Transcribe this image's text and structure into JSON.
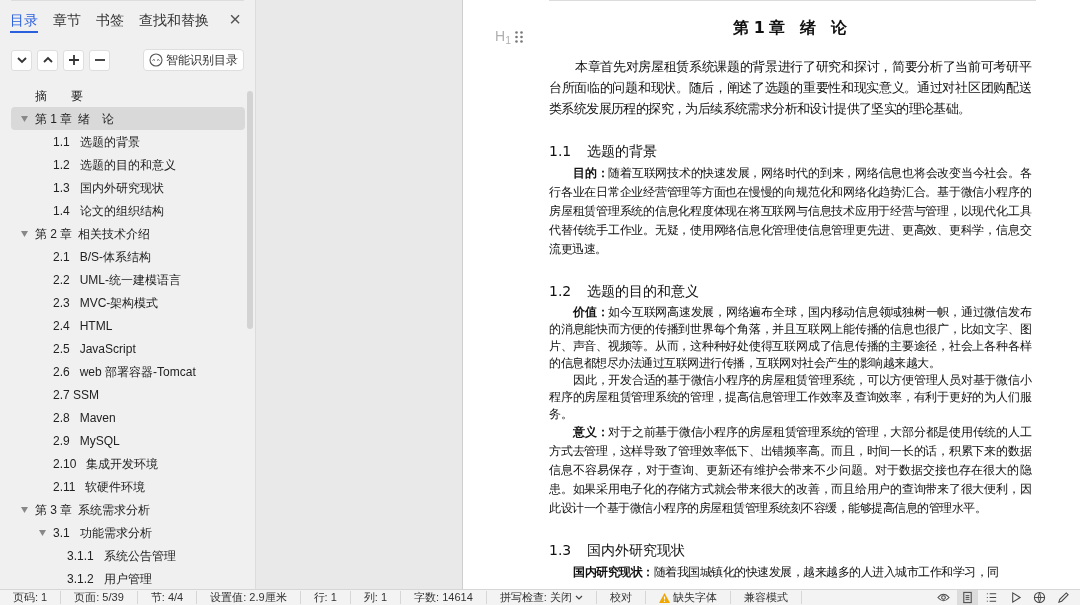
{
  "sidebar": {
    "tabs": [
      {
        "label": "目录",
        "selected": true
      },
      {
        "label": "章节",
        "selected": false
      },
      {
        "label": "书签",
        "selected": false
      },
      {
        "label": "查找和替换",
        "selected": false
      }
    ],
    "close": "×",
    "smart_button": "智能识别目录",
    "toc": [
      {
        "title": "摘　　要",
        "selected": false
      },
      {
        "num": "第 1 章",
        "title": "绪　论",
        "selected": true,
        "expanded": true,
        "children": [
          {
            "num": "1.1",
            "title": "选题的背景",
            "selected": false
          },
          {
            "num": "1.2",
            "title": "选题的目的和意义",
            "selected": false
          },
          {
            "num": "1.3",
            "title": "国内外研究现状",
            "selected": false
          },
          {
            "num": "1.4",
            "title": "论文的组织结构",
            "selected": false
          }
        ]
      },
      {
        "num": "第 2 章",
        "title": "相关技术介绍",
        "selected": false,
        "expanded": true,
        "children": [
          {
            "num": "2.1",
            "title": "B/S-体系结构",
            "selected": false
          },
          {
            "num": "2.2",
            "title": "UML-统一建模语言",
            "selected": false
          },
          {
            "num": "2.3",
            "title": "MVC-架构模式",
            "selected": false
          },
          {
            "num": "2.4",
            "title": "HTML",
            "selected": false
          },
          {
            "num": "2.5",
            "title": "JavaScript",
            "selected": false
          },
          {
            "num": "2.6",
            "title": "web 部署容器-Tomcat",
            "selected": false
          },
          {
            "num": "2.7 SSM",
            "selected": false
          },
          {
            "num": "2.8",
            "title": "Maven",
            "selected": false
          },
          {
            "num": "2.9",
            "title": "MySQL",
            "selected": false
          },
          {
            "num": "2.10",
            "title": "集成开发环境",
            "selected": false
          },
          {
            "num": "2.11",
            "title": "软硬件环境",
            "selected": false
          }
        ]
      },
      {
        "num": "第 3 章",
        "title": "系统需求分析",
        "selected": false,
        "expanded": true,
        "children": [
          {
            "num": "3.1",
            "title": "功能需求分析",
            "selected": false,
            "expanded": true,
            "children": [
              {
                "num": "3.1.1",
                "title": "系统公告管理",
                "selected": false
              },
              {
                "num": "3.1.2",
                "title": "用户管理",
                "selected": false
              }
            ]
          }
        ]
      }
    ]
  },
  "document": {
    "heading_marker": "H$_{1}$",
    "blocks": [
      {
        "kind": "title",
        "text": "第 1 章　绪　论"
      },
      {
        "kind": "intro",
        "text": "本章首先对房屋租赁系统课题的背景进行了研究和探讨，简要分析了当前可考研平台所面临的问题和现状。随后，阐述了选题的重要性和现实意义。通过对社区团购配送类系统发展历程的探究，为后续系统需求分析和设计提供了坚实的理论基础。"
      },
      {
        "kind": "heading",
        "num": "1.1",
        "text": "选题的背景"
      },
      {
        "kind": "para",
        "text": "**目的：**随着互联网技术的快速发展，网络时代的到来，网络信息也将会改变当今社会。各行各业在日常企业经营管理等方面也在慢慢的向规范化和网络化趋势汇合。基于微信小程序的房屋租赁管理系统的信息化程度体现在将互联网与信息技术应用于经营与管理，以现代化工具代替传统手工作业。无疑，使用网络信息化管理使信息管理更先进、更高效、更科学，信息交流更迅速。"
      },
      {
        "kind": "heading",
        "num": "1.2",
        "text": "选题的目的和意义"
      },
      {
        "kind": "dense",
        "text": "**价值：**如今互联网高速发展，网络遍布全球，国内移动信息领域独树一帜，通过微信发布的消息能快而方便的传播到世界每个角落，并且互联网上能传播的信息也很广，比如文字、图片、声音、视频等。从而，这种种好处使得互联网成了信息传播的主要途径，社会上各种各样的信息都想尽办法通过互联网进行传播，互联网对社会产生的影响越来越大。"
      },
      {
        "kind": "dense",
        "text": "因此，开发合适的基于微信小程序的房屋租赁管理系统，可以方便管理人员对基于微信小程序的房屋租赁管理系统的管理，提高信息管理工作效率及查询效率，有利于更好的为人们服务。"
      },
      {
        "kind": "para",
        "text": "**意义：**对于之前基于微信小程序的房屋租赁管理系统的管理，大部分都是使用传统的人工方式去管理，这样导致了管理效率低下、出错频率高。而且，时间一长的话，积累下来的数据信息不容易保存，对于查询、更新还有维护会带来不少问题。对于数据交接也存在很大的隐患。如果采用电子化的存储方式就会带来很大的改善，而且给用户的查询带来了很大便利，因此设计一个基于微信小程序的房屋租赁管理系统刻不容缓，能够提高信息的管理水平。"
      },
      {
        "kind": "heading",
        "num": "1.3",
        "text": "国内外研究现状"
      },
      {
        "kind": "para",
        "text": "**国内研究现状：**随着我国城镇化的快速发展，越来越多的人进入城市工作和学习，同"
      }
    ]
  },
  "status_bar": {
    "items": [
      {
        "kind": "text",
        "label": "页码: 1"
      },
      {
        "kind": "text",
        "label": "页面: 5/39"
      },
      {
        "kind": "text",
        "label": "节: 4/4"
      },
      {
        "kind": "text",
        "label": "设置值: 2.9厘米"
      },
      {
        "kind": "text",
        "label": "行: 1"
      },
      {
        "kind": "text",
        "label": "列: 1"
      },
      {
        "kind": "text",
        "label": "字数: 14614"
      },
      {
        "kind": "dropdown",
        "label": "拼写检查: 关闭"
      },
      {
        "kind": "text",
        "label": "校对"
      },
      {
        "kind": "warning",
        "label": "缺失字体"
      },
      {
        "kind": "text",
        "label": "兼容模式"
      }
    ],
    "views": [
      {
        "selected": false
      },
      {
        "selected": true
      },
      {
        "selected": false
      },
      {
        "selected": false
      },
      {
        "selected": false
      },
      {
        "selected": false
      }
    ]
  }
}
